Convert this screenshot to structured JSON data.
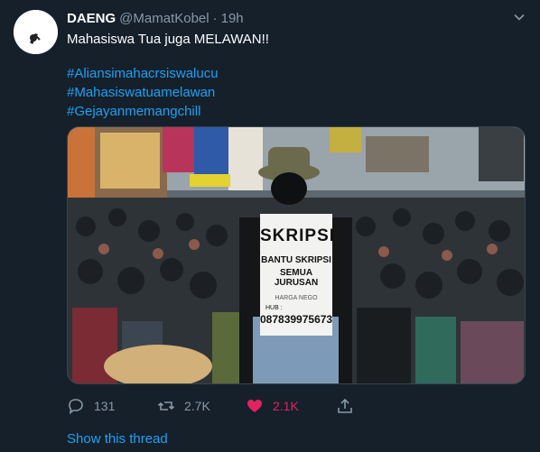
{
  "tweet": {
    "author": {
      "display_name": "DAENG",
      "handle": "@MamatKobel",
      "separator": "·",
      "time": "19h"
    },
    "text": "Mahasiswa Tua juga MELAWAN!!",
    "hashtags": [
      "#Aliansimahacrsiswalucu",
      "#Mahasiswatuamelawan",
      "#Gejayanmemangchill"
    ],
    "photo": {
      "sign_lines": [
        "SKRIPSI",
        "BANTU SKRIPSI",
        "SEMUA JURUSAN",
        "HARGA NEGO",
        "HUB :",
        "087839975673"
      ],
      "icon": "protest-crowd-photo"
    },
    "actions": {
      "reply_count": "131",
      "retweet_count": "2.7K",
      "like_count": "2.1K"
    },
    "show_thread": "Show this thread"
  },
  "colors": {
    "background": "#15202b",
    "link": "#1da1f2",
    "muted": "#8899a6",
    "like": "#e0245e"
  }
}
